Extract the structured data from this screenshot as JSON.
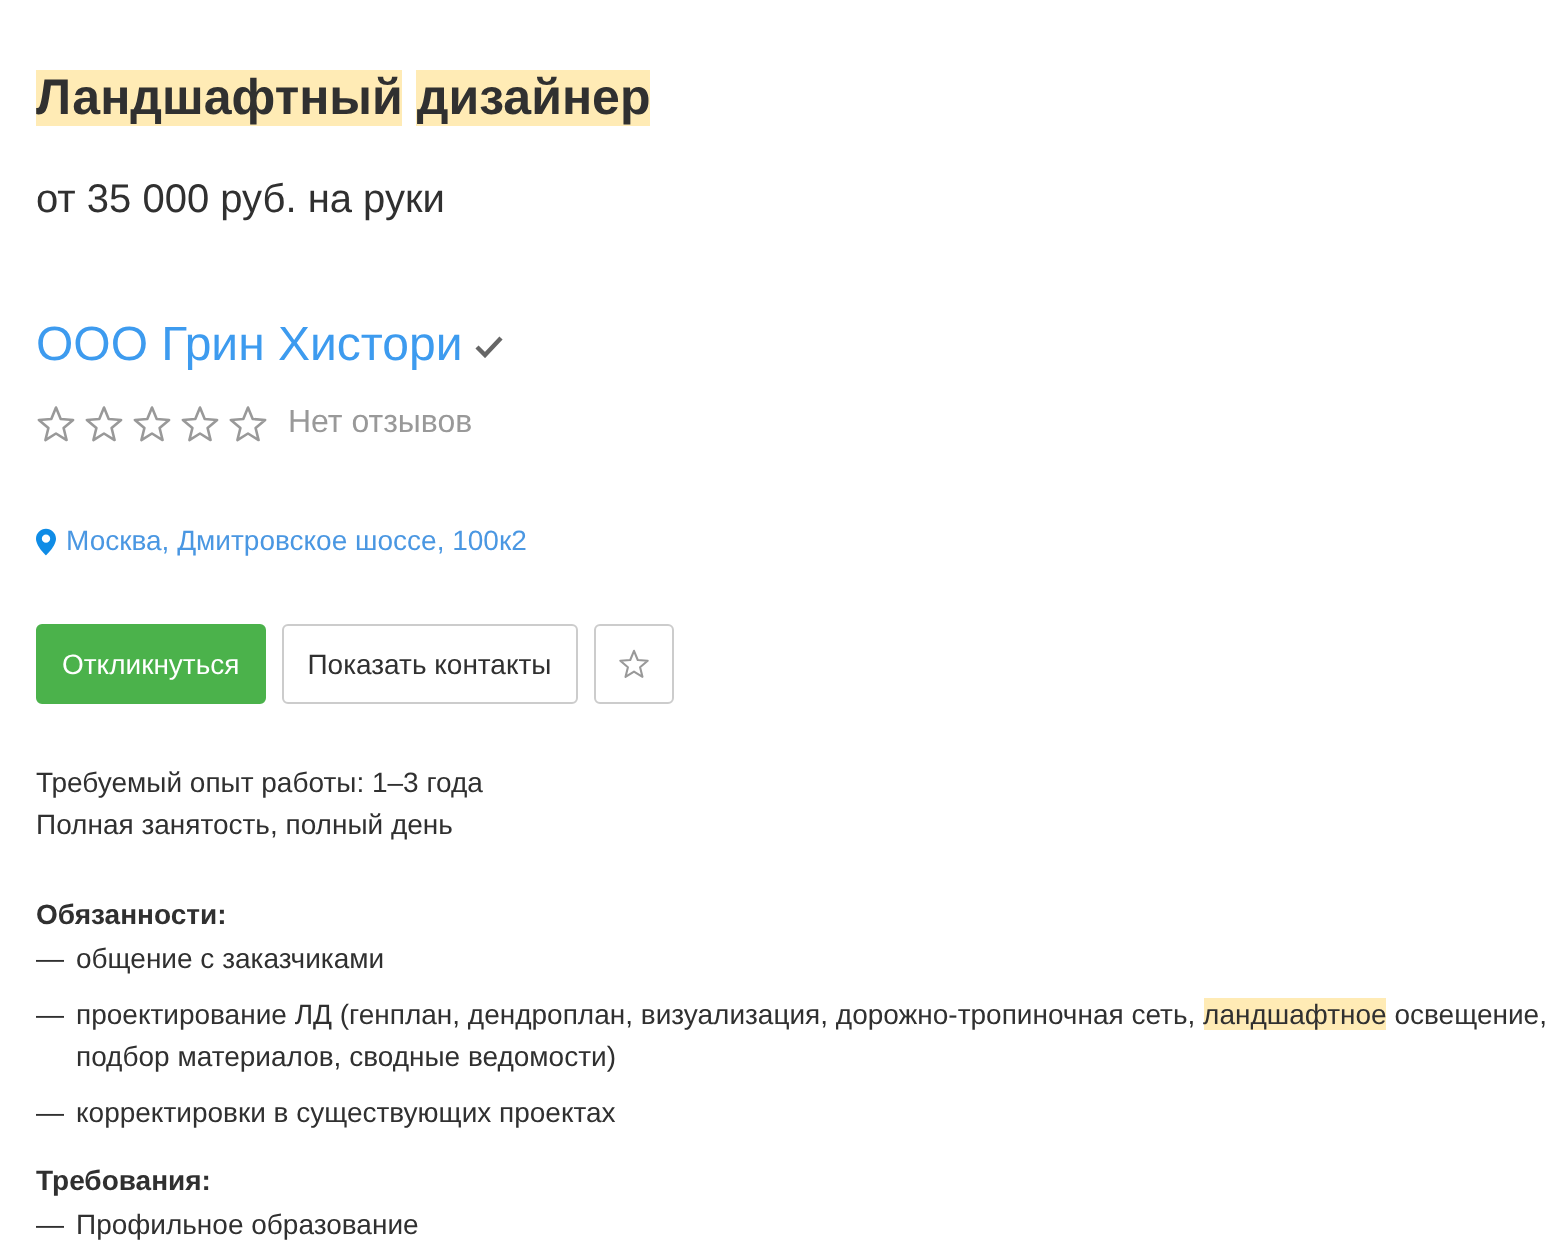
{
  "vacancy": {
    "title": [
      {
        "text": "Ландшафтный",
        "highlighted": true
      },
      {
        "text": "дизайнер",
        "highlighted": true
      }
    ],
    "salary": "от 35 000 руб. на руки"
  },
  "company": {
    "name": "ООО Грин Хистори",
    "verified": true,
    "stars": 0,
    "reviews": "Нет отзывов",
    "address": "Москва, Дмитровское шоссе, 100к2"
  },
  "actions": [
    {
      "kind": "primary",
      "label": "Откликнуться"
    },
    {
      "kind": "secondary",
      "label": "Показать контакты"
    },
    {
      "kind": "favorite"
    }
  ],
  "details": [
    "Требуемый опыт работы: 1–3 года",
    "Полная занятость, полный день"
  ],
  "sections": [
    {
      "heading": "Обязанности:",
      "items": [
        {
          "marker": "—",
          "parts": [
            {
              "text": "общение с заказчиками",
              "highlighted": false
            }
          ]
        },
        {
          "marker": "—",
          "parts": [
            {
              "text": "проектирование ЛД (генплан, дендроплан, визуализация, дорожно-тропиночная сеть, ",
              "highlighted": false
            },
            {
              "text": "ландшафтное",
              "highlighted": true
            },
            {
              "text": " освещение, подбор материалов, сводные ведомости)",
              "highlighted": false
            }
          ]
        },
        {
          "marker": "—",
          "parts": [
            {
              "text": "корректировки в существующих проектах",
              "highlighted": false
            }
          ]
        }
      ]
    },
    {
      "heading": "Требования:",
      "items": [
        {
          "marker": "—",
          "parts": [
            {
              "text": "Профильное образование",
              "highlighted": false
            }
          ]
        }
      ]
    }
  ]
}
